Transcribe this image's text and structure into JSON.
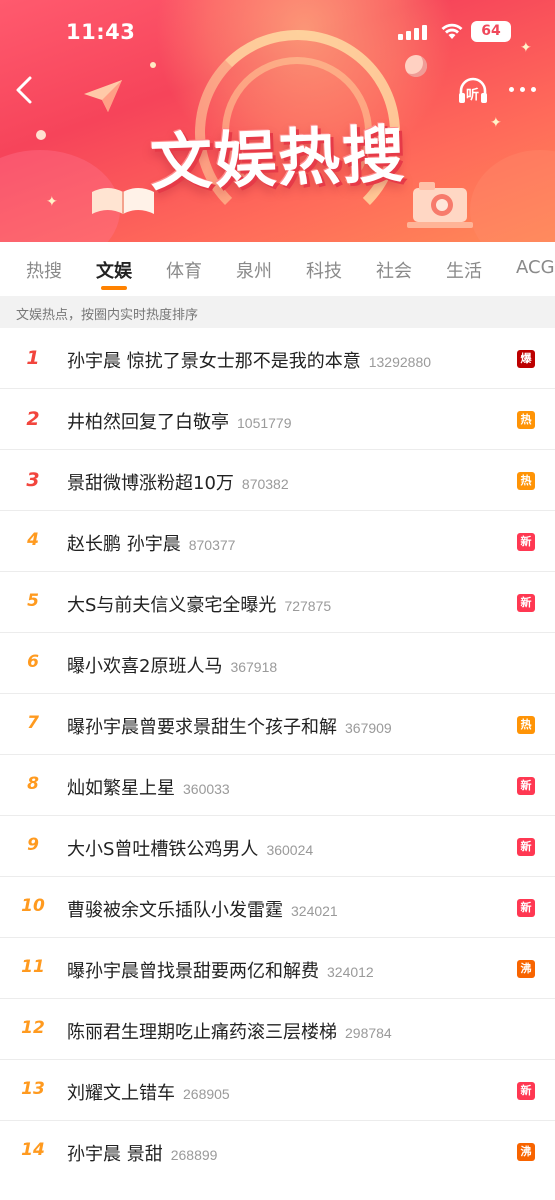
{
  "status_bar": {
    "time": "11:43",
    "battery": "64"
  },
  "header": {
    "title": "文娱热搜",
    "listen_label": "听"
  },
  "tabs": [
    {
      "label": "热搜",
      "active": false
    },
    {
      "label": "文娱",
      "active": true
    },
    {
      "label": "体育",
      "active": false
    },
    {
      "label": "泉州",
      "active": false
    },
    {
      "label": "科技",
      "active": false
    },
    {
      "label": "社会",
      "active": false
    },
    {
      "label": "生活",
      "active": false
    },
    {
      "label": "ACG",
      "active": false
    }
  ],
  "subheader": "文娱热点，按圈内实时热度排序",
  "items": [
    {
      "rank": "1",
      "title": "孙宇晨 惊扰了景女士那不是我的本意",
      "count": "13292880",
      "badge": "爆"
    },
    {
      "rank": "2",
      "title": "井柏然回复了白敬亭",
      "count": "1051779",
      "badge": "热"
    },
    {
      "rank": "3",
      "title": "景甜微博涨粉超10万",
      "count": "870382",
      "badge": "热"
    },
    {
      "rank": "4",
      "title": "赵长鹏 孙宇晨",
      "count": "870377",
      "badge": "新"
    },
    {
      "rank": "5",
      "title": "大S与前夫信义豪宅全曝光",
      "count": "727875",
      "badge": "新"
    },
    {
      "rank": "6",
      "title": "曝小欢喜2原班人马",
      "count": "367918",
      "badge": ""
    },
    {
      "rank": "7",
      "title": "曝孙宇晨曾要求景甜生个孩子和解",
      "count": "367909",
      "badge": "热"
    },
    {
      "rank": "8",
      "title": "灿如繁星上星",
      "count": "360033",
      "badge": "新"
    },
    {
      "rank": "9",
      "title": "大小S曾吐槽铁公鸡男人",
      "count": "360024",
      "badge": "新"
    },
    {
      "rank": "10",
      "title": "曹骏被余文乐插队小发雷霆",
      "count": "324021",
      "badge": "新"
    },
    {
      "rank": "11",
      "title": "曝孙宇晨曾找景甜要两亿和解费",
      "count": "324012",
      "badge": "沸"
    },
    {
      "rank": "12",
      "title": "陈丽君生理期吃止痛药滚三层楼梯",
      "count": "298784",
      "badge": ""
    },
    {
      "rank": "13",
      "title": "刘耀文上错车",
      "count": "268905",
      "badge": "新"
    },
    {
      "rank": "14",
      "title": "孙宇晨 景甜",
      "count": "268899",
      "badge": "沸"
    }
  ],
  "colors": {
    "accent": "#ff8200",
    "rank_top": "#f2453d",
    "rank_other": "#ff9a1f",
    "badge_bao": "#bd0000",
    "badge_re": "#ff9406",
    "badge_xin": "#ff3852",
    "badge_fei": "#f86400"
  }
}
